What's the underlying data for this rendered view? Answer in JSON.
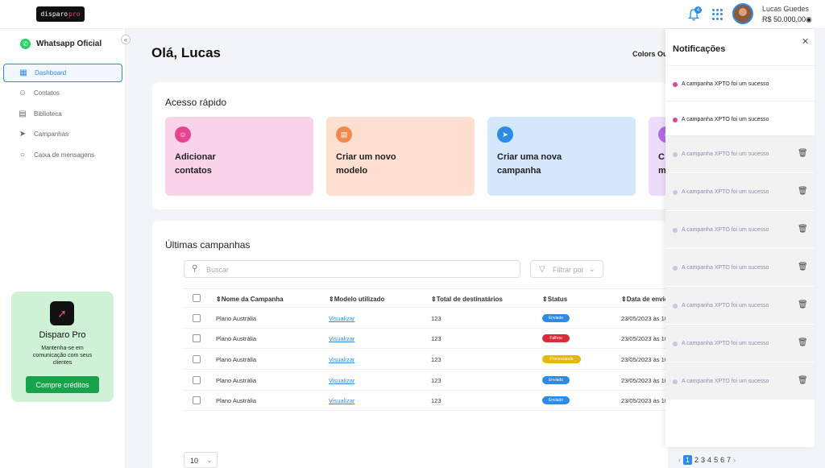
{
  "topbar": {
    "logo_text": "disparo",
    "logo_accent": "pro",
    "notification_count": "4",
    "user_name": "Lucas Guedes",
    "balance": "R$ 50.000,00"
  },
  "sidebar": {
    "channel_title": "Whatsapp Oficial",
    "items": [
      {
        "label": "Dashboard",
        "icon": "grid-icon",
        "active": true
      },
      {
        "label": "Contatos",
        "icon": "user-icon"
      },
      {
        "label": "Biblioteca",
        "icon": "book-icon"
      },
      {
        "label": "Campanhas",
        "icon": "send-icon"
      },
      {
        "label": "Caixa de mensagens",
        "icon": "chat-icon"
      }
    ],
    "promo": {
      "title": "Disparo Pro",
      "text": "Mantenha-se em comunicação com seus clientes",
      "button": "Compre créditos"
    }
  },
  "main": {
    "greeting": "Olá, Lucas",
    "company": "Colors Ou",
    "quick_access": {
      "title": "Acesso rápido",
      "items": [
        {
          "label": "Adicionar\ncontatos",
          "bg": "#f9d4e8",
          "icon_color": "#e84393",
          "icon": "user-plus-icon"
        },
        {
          "label": "Criar um novo\nmodelo",
          "bg": "#fde0d2",
          "icon_color": "#f2884b",
          "icon": "book-icon"
        },
        {
          "label": "Criar uma nova\ncampanha",
          "bg": "#d4e7fb",
          "icon_color": "#2b8be6",
          "icon": "send-icon"
        },
        {
          "label": "C\nm",
          "bg": "#eedcfb",
          "icon_color": "#b06ae6",
          "icon": "chat-icon"
        }
      ]
    },
    "campaigns": {
      "title": "Últimas campanhas",
      "search_placeholder": "Buscar",
      "filter_label": "Filtrar por",
      "columns": [
        "Nome da Campanha",
        "Modelo utilizado",
        "Total de destinatários",
        "Status",
        "Data de envio"
      ],
      "rows": [
        {
          "name": "Plano Austrália",
          "model": "Visualizar",
          "total": "123",
          "status": "Enviado",
          "status_color": "#2b8be6",
          "date": "23/05/2023 às 10"
        },
        {
          "name": "Plano Austrália",
          "model": "Visualizar",
          "total": "123",
          "status": "Falhou",
          "status_color": "#d92b3a",
          "date": "23/05/2023 às 10"
        },
        {
          "name": "Plano Austrália",
          "model": "Visualizar",
          "total": "123",
          "status": "Processando",
          "status_color": "#e6b800",
          "date": "23/05/2023 às 10"
        },
        {
          "name": "Plano Austrália",
          "model": "Visualizar",
          "total": "123",
          "status": "Enviado",
          "status_color": "#2b8be6",
          "date": "23/05/2023 às 10"
        },
        {
          "name": "Plano Austrália",
          "model": "Visualizar",
          "total": "123",
          "status": "Enviado",
          "status_color": "#2b8be6",
          "date": "23/05/2023 às 10"
        }
      ],
      "per_page": "10",
      "pages": [
        "1",
        "2",
        "3",
        "4",
        "5",
        "6",
        "7"
      ],
      "current_page": "1"
    }
  },
  "notifications": {
    "title": "Notificações",
    "items": [
      {
        "text": "A campanha XPTO foi um sucesso",
        "unread": true
      },
      {
        "text": "A campanha XPTO foi um sucesso",
        "unread": true
      },
      {
        "text": "A campanha XPTO foi um sucesso",
        "unread": false
      },
      {
        "text": "A campanha XPTO foi um sucesso",
        "unread": false
      },
      {
        "text": "A campanha XPTO foi um sucesso",
        "unread": false
      },
      {
        "text": "A campanha XPTO foi um sucesso",
        "unread": false
      },
      {
        "text": "A campanha XPTO foi um sucesso",
        "unread": false
      },
      {
        "text": "A campanha XPTO foi um sucesso",
        "unread": false
      },
      {
        "text": "A campanha XPTO foi um sucesso",
        "unread": false
      }
    ]
  },
  "colors": {
    "accent": "#2b8be6",
    "brand_pink": "#e84393",
    "promo_green": "#17a34a",
    "unread_dot": "#e84393",
    "read_dot": "#c5c8e8"
  }
}
